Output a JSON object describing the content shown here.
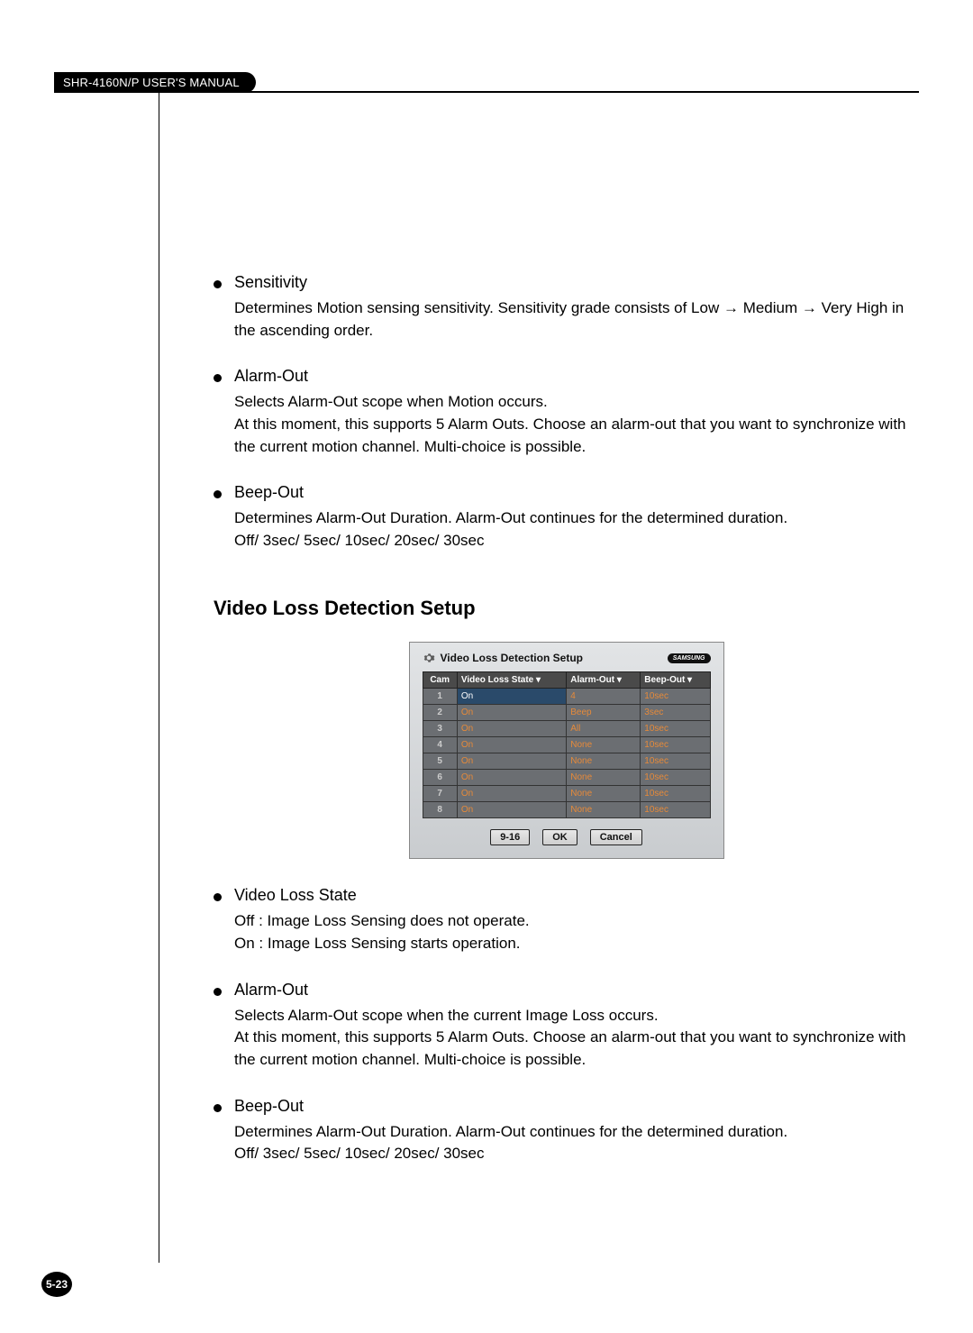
{
  "header": {
    "manual_title": "SHR-4160N/P USER'S MANUAL"
  },
  "items_top": [
    {
      "head": "Sensitivity",
      "body": "Determines Motion sensing sensitivity. Sensitivity grade consists of Low → Medium → Very High in the ascending order."
    },
    {
      "head": "Alarm-Out",
      "body": "Selects Alarm-Out scope when Motion occurs.\nAt this moment, this supports 5 Alarm Outs. Choose an alarm-out that you want to synchronize with the current motion channel. Multi-choice is possible."
    },
    {
      "head": "Beep-Out",
      "body": "Determines Alarm-Out Duration. Alarm-Out continues for the determined duration.\nOff/ 3sec/ 5sec/ 10sec/ 20sec/ 30sec"
    }
  ],
  "section_title": "Video Loss Detection Setup",
  "screenshot": {
    "title": "Video Loss Detection Setup",
    "brand": "SAMSUNG",
    "headers": [
      "Cam",
      "Video Loss State ▾",
      "Alarm-Out ▾",
      "Beep-Out ▾"
    ],
    "rows": [
      {
        "cam": "1",
        "state": "On",
        "alarm": "4",
        "beep": "10sec",
        "state_sel": true
      },
      {
        "cam": "2",
        "state": "On",
        "alarm": "Beep",
        "beep": "3sec"
      },
      {
        "cam": "3",
        "state": "On",
        "alarm": "All",
        "beep": "10sec"
      },
      {
        "cam": "4",
        "state": "On",
        "alarm": "None",
        "beep": "10sec"
      },
      {
        "cam": "5",
        "state": "On",
        "alarm": "None",
        "beep": "10sec"
      },
      {
        "cam": "6",
        "state": "On",
        "alarm": "None",
        "beep": "10sec"
      },
      {
        "cam": "7",
        "state": "On",
        "alarm": "None",
        "beep": "10sec"
      },
      {
        "cam": "8",
        "state": "On",
        "alarm": "None",
        "beep": "10sec"
      }
    ],
    "buttons": {
      "range": "9-16",
      "ok": "OK",
      "cancel": "Cancel"
    }
  },
  "items_bottom": [
    {
      "head": "Video Loss State",
      "body": "Off : Image Loss Sensing does not operate.\nOn : Image Loss Sensing starts operation."
    },
    {
      "head": "Alarm-Out",
      "body": "Selects Alarm-Out scope when the current Image Loss occurs.\nAt this moment, this supports 5 Alarm Outs. Choose an alarm-out that you want to synchronize with the current motion channel. Multi-choice is possible."
    },
    {
      "head": "Beep-Out",
      "body": "Determines Alarm-Out Duration. Alarm-Out continues for the determined duration.\nOff/ 3sec/ 5sec/ 10sec/ 20sec/ 30sec"
    }
  ],
  "page_number": "5-23"
}
